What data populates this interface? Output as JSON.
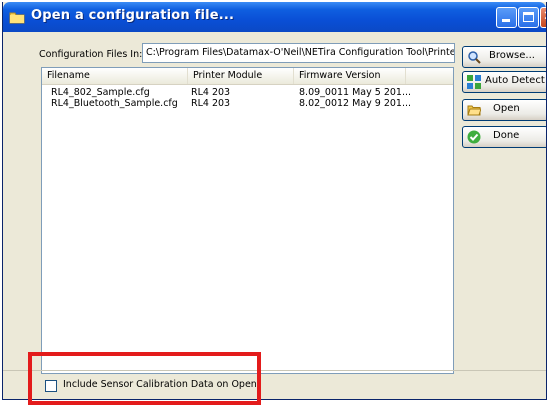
{
  "window": {
    "title": "Open a configuration file..."
  },
  "path": {
    "label": "Configuration Files In:",
    "value": "C:\\Program Files\\Datamax-O'Neil\\NETira Configuration Tool\\Printer"
  },
  "file_list": {
    "columns": [
      "Filename",
      "Printer Module",
      "Firmware Version"
    ],
    "rows": [
      [
        "RL4_802_Sample.cfg",
        "RL4 203",
        "8.09_0011 May  5 201..."
      ],
      [
        "RL4_Bluetooth_Sample.cfg",
        "RL4 203",
        "8.02_0012 May  9 201..."
      ]
    ]
  },
  "buttons": {
    "browse": "Browse...",
    "auto_detect": "Auto Detect",
    "open": "Open",
    "done": "Done"
  },
  "options": {
    "include_calibration_label": "Include Sensor Calibration Data on Open.",
    "include_calibration_checked": false
  },
  "colors": {
    "titlebar": "#0a4fd6",
    "dialog_bg": "#ece9d8",
    "highlight": "#e31b1b"
  },
  "icons": {
    "title": "folder-icon",
    "browse": "magnifier-icon",
    "auto_detect": "auto-detect-icon",
    "open": "open-folder-icon",
    "done": "check-icon"
  }
}
